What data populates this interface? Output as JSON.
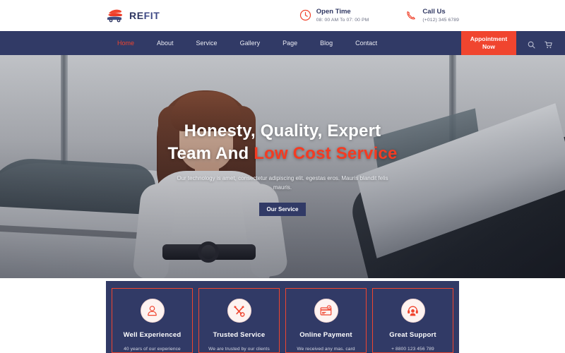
{
  "brand": {
    "icon": "car-logo-icon",
    "name_part1": "RE",
    "name_part2": "FIT"
  },
  "topbar": {
    "open_time": {
      "icon": "clock-icon",
      "title": "Open Time",
      "value": "08: 00 AM To 07: 00 PM"
    },
    "call_us": {
      "icon": "phone-icon",
      "title": "Call Us",
      "value": "(+012) 345 6789"
    }
  },
  "nav": {
    "items": [
      {
        "label": "Home",
        "active": true
      },
      {
        "label": "About",
        "active": false
      },
      {
        "label": "Service",
        "active": false
      },
      {
        "label": "Gallery",
        "active": false
      },
      {
        "label": "Page",
        "active": false
      },
      {
        "label": "Blog",
        "active": false
      },
      {
        "label": "Contact",
        "active": false
      }
    ],
    "appointment_line1": "Appointment",
    "appointment_line2": "Now",
    "search_icon": "search-icon",
    "cart_icon": "shopping-cart-icon"
  },
  "hero": {
    "heading_line1": "Honesty, Quality, Expert",
    "heading_line2_plain": "Team And ",
    "heading_line2_accent": "Low Cost Service",
    "paragraph": "Our technology is amet, consectetur adipiscing elit. egestas eros. Mauris blandit felis mauris.",
    "button_label": "Our Service"
  },
  "features": [
    {
      "icon": "user-person-icon",
      "title": "Well Experienced",
      "subtitle": "40 years of our experience"
    },
    {
      "icon": "crossed-tools-icon",
      "title": "Trusted Service",
      "subtitle": "We are trusted by our clients"
    },
    {
      "icon": "credit-card-icon",
      "title": "Online Payment",
      "subtitle": "We received any mas. card"
    },
    {
      "icon": "headset-support-icon",
      "title": "Great Support",
      "subtitle": "+ 8800 123 456 789"
    }
  ],
  "colors": {
    "navy": "#313a66",
    "red": "#f0452f",
    "accent_heading": "#f43b22",
    "white": "#ffffff"
  }
}
